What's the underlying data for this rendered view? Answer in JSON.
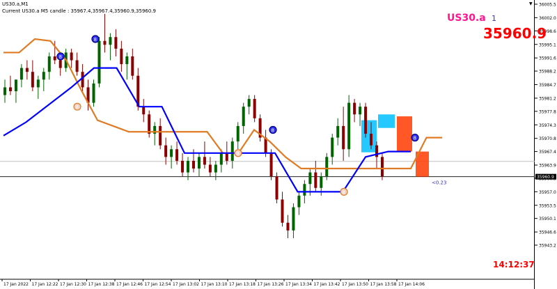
{
  "window": {
    "title": "US30.a,M1",
    "candle_info": "Current US30.a M5 candle : 35967.4,35967.4,35960.9,35960.9",
    "symbol_label": "US30.a",
    "count_label": "1",
    "price_label": "35960.9",
    "clock": "14:12:37",
    "delta_label": "<0.23",
    "marker_glyph": "8",
    "arrow_glyph": "▼"
  },
  "chart_data": {
    "type": "candlestick",
    "y_ticks": [
      "36005.5",
      "36002.0",
      "35998.6",
      "35995.1",
      "35991.6",
      "35988.2",
      "35984.7",
      "35981.2",
      "35977.8",
      "35974.3",
      "35970.8",
      "35967.4",
      "35963.9",
      "35960.5",
      "35957.0",
      "35953.5",
      "35950.1",
      "35946.6",
      "35943.2"
    ],
    "x_ticks": [
      "17 Jan 2022",
      "17 Jan 12:22",
      "17 Jan 12:30",
      "17 Jan 12:38",
      "17 Jan 12:46",
      "17 Jan 12:54",
      "17 Jan 13:02",
      "17 Jan 13:10",
      "17 Jan 13:18",
      "17 Jan 13:26",
      "17 Jan 13:34",
      "17 Jan 13:42",
      "17 Jan 13:50",
      "17 Jan 13:58",
      "17 Jan 14:06"
    ],
    "current_price": "35960.9",
    "current_price_value": 35960.9,
    "grid": false,
    "colors": {
      "up": "#006400",
      "down": "#8b0000",
      "orange_line": "#e07b25",
      "blue_line": "#0000ff",
      "cyan_box": "#00bfff",
      "red_box": "#ff3b00",
      "price_line": "#000000",
      "bid_line": "#c0c0c0"
    },
    "orange_line": [
      [
        0,
        35993.0
      ],
      [
        1,
        35993.0
      ],
      [
        2,
        35996.5
      ],
      [
        3,
        35996.0
      ],
      [
        4,
        35991.0
      ],
      [
        5,
        35983.0
      ],
      [
        6,
        35975.5
      ],
      [
        7,
        35974.0
      ],
      [
        8,
        35972.5
      ],
      [
        9,
        35972.5
      ],
      [
        10,
        35972.5
      ],
      [
        11,
        35972.5
      ],
      [
        12,
        35972.5
      ],
      [
        13,
        35972.5
      ],
      [
        14,
        35967.0
      ],
      [
        15,
        35967.0
      ],
      [
        16,
        35973.0
      ],
      [
        17,
        35970.0
      ],
      [
        18,
        35966.0
      ],
      [
        19,
        35963.0
      ],
      [
        20,
        35963.0
      ],
      [
        21,
        35963.0
      ],
      [
        22,
        35963.0
      ],
      [
        23,
        35963.0
      ],
      [
        24,
        35963.0
      ],
      [
        25,
        35963.0
      ],
      [
        26,
        35963.0
      ],
      [
        27,
        35971.0
      ],
      [
        28,
        35971.0
      ]
    ],
    "blue_line": [
      [
        0,
        35971.5
      ],
      [
        1,
        35975.0
      ],
      [
        2,
        35979.5
      ],
      [
        3,
        35984.0
      ],
      [
        4,
        35989.0
      ],
      [
        5,
        35989.0
      ],
      [
        6,
        35979.0
      ],
      [
        7,
        35979.0
      ],
      [
        8,
        35967.0
      ],
      [
        9,
        35967.0
      ],
      [
        10,
        35967.0
      ],
      [
        11,
        35967.0
      ],
      [
        12,
        35967.0
      ],
      [
        13,
        35957.0
      ],
      [
        14,
        35957.0
      ],
      [
        15,
        35957.0
      ],
      [
        16,
        35966.0
      ],
      [
        17,
        35967.4
      ],
      [
        18,
        35967.4
      ]
    ],
    "candles": [
      [
        35982,
        35986,
        35980,
        35984
      ],
      [
        35984,
        35987,
        35982,
        35983
      ],
      [
        35983,
        35986,
        35980,
        35986
      ],
      [
        35986,
        35990,
        35984,
        35989
      ],
      [
        35989,
        35991,
        35986,
        35988
      ],
      [
        35988,
        35991,
        35983,
        35984
      ],
      [
        35984,
        35987,
        35981,
        35986
      ],
      [
        35986,
        35989,
        35983,
        35988
      ],
      [
        35988,
        35993,
        35986,
        35992
      ],
      [
        35992,
        35996,
        35990,
        35991
      ],
      [
        35991,
        35993,
        35987,
        35989
      ],
      [
        35989,
        35994,
        35988,
        35993
      ],
      [
        35993,
        35994,
        35989,
        35991
      ],
      [
        35991,
        35993,
        35987,
        35988
      ],
      [
        35988,
        35990,
        35983,
        35984
      ],
      [
        35984,
        35986,
        35978,
        35980
      ],
      [
        35980,
        35986,
        35979,
        35985
      ],
      [
        35985,
        35997,
        35984,
        35996
      ],
      [
        35996,
        36003,
        35993,
        35995
      ],
      [
        35995,
        35998,
        35991,
        35997
      ],
      [
        35997,
        35999,
        35992,
        35994
      ],
      [
        35994,
        35996,
        35988,
        35990
      ],
      [
        35990,
        35993,
        35986,
        35992
      ],
      [
        35992,
        35994,
        35986,
        35987
      ],
      [
        35987,
        35989,
        35978,
        35979
      ],
      [
        35979,
        35981,
        35975,
        35977
      ],
      [
        35977,
        35978,
        35971,
        35972
      ],
      [
        35972,
        35975,
        35969,
        35974
      ],
      [
        35974,
        35976,
        35968,
        35969
      ],
      [
        35969,
        35971,
        35964,
        35966
      ],
      [
        35966,
        35969,
        35963,
        35968
      ],
      [
        35968,
        35970,
        35964,
        35965
      ],
      [
        35965,
        35967,
        35961,
        35962
      ],
      [
        35962,
        35966,
        35960,
        35965
      ],
      [
        35965,
        35968,
        35962,
        35963
      ],
      [
        35963,
        35967,
        35961,
        35966
      ],
      [
        35966,
        35970,
        35963,
        35964
      ],
      [
        35964,
        35966,
        35961,
        35962
      ],
      [
        35962,
        35965,
        35960,
        35964
      ],
      [
        35964,
        35968,
        35962,
        35967
      ],
      [
        35967,
        35970,
        35964,
        35965
      ],
      [
        35965,
        35971,
        35963,
        35970
      ],
      [
        35970,
        35975,
        35968,
        35974
      ],
      [
        35974,
        35980,
        35972,
        35979
      ],
      [
        35979,
        35982,
        35977,
        35981
      ],
      [
        35981,
        35982,
        35975,
        35976
      ],
      [
        35976,
        35977,
        35970,
        35971
      ],
      [
        35971,
        35973,
        35966,
        35967
      ],
      [
        35967,
        35968,
        35960,
        35961
      ],
      [
        35961,
        35962,
        35954,
        35955
      ],
      [
        35955,
        35957,
        35948,
        35949
      ],
      [
        35949,
        35951,
        35945,
        35947
      ],
      [
        35947,
        35954,
        35945,
        35953
      ],
      [
        35953,
        35957,
        35951,
        35956
      ],
      [
        35956,
        35960,
        35954,
        35959
      ],
      [
        35959,
        35963,
        35956,
        35962
      ],
      [
        35962,
        35965,
        35957,
        35958
      ],
      [
        35958,
        35962,
        35956,
        35961
      ],
      [
        35961,
        35967,
        35960,
        35966
      ],
      [
        35966,
        35972,
        35964,
        35971
      ],
      [
        35971,
        35976,
        35969,
        35974
      ],
      [
        35974,
        35979,
        35965,
        35968
      ],
      [
        35968,
        35982,
        35966,
        35980
      ],
      [
        35980,
        35981,
        35975,
        35977
      ],
      [
        35977,
        35980,
        35974,
        35979
      ],
      [
        35979,
        35980,
        35971,
        35972
      ],
      [
        35972,
        35975,
        35968,
        35969
      ],
      [
        35969,
        35970,
        35963,
        35966
      ],
      [
        35966,
        35967,
        35960,
        35961
      ]
    ]
  }
}
